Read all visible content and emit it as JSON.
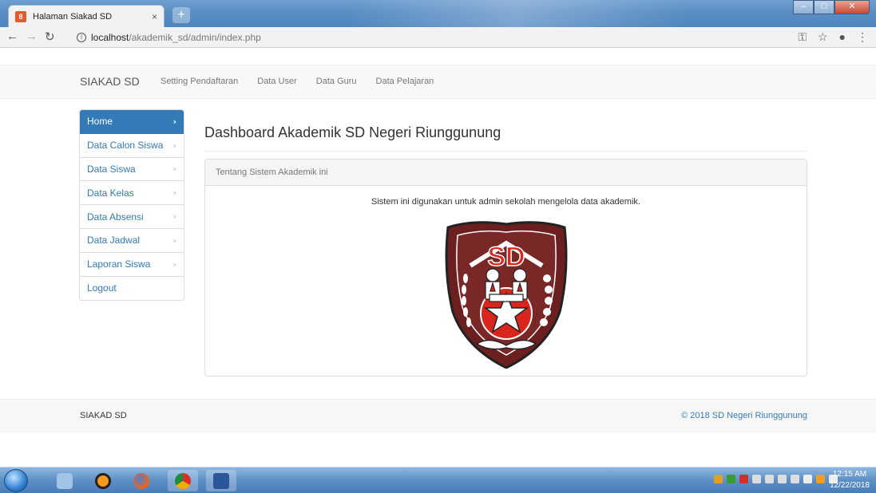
{
  "browser": {
    "tab_title": "Halaman Siakad SD",
    "tab_close": "×",
    "new_tab": "+",
    "url_host": "localhost",
    "url_path": "/akademik_sd/admin/index.php",
    "info_icon": "i"
  },
  "navbar": {
    "brand": "SIAKAD SD",
    "links": [
      "Setting Pendaftaran",
      "Data User",
      "Data Guru",
      "Data Pelajaran"
    ]
  },
  "sidebar": {
    "items": [
      {
        "label": "Home",
        "active": true
      },
      {
        "label": "Data Calon Siswa"
      },
      {
        "label": "Data Siswa"
      },
      {
        "label": "Data Kelas"
      },
      {
        "label": "Data Absensi"
      },
      {
        "label": "Data Jadwal"
      },
      {
        "label": "Laporan Siswa"
      },
      {
        "label": "Logout"
      }
    ]
  },
  "main": {
    "title": "Dashboard Akademik SD Negeri Riunggunung",
    "panel_heading": "Tentang Sistem Akademik ini",
    "panel_text": "Sistem ini digunakan untuk admin sekolah mengelola data akademik.",
    "logo_text": "SD"
  },
  "footer": {
    "left": "SIAKAD SD",
    "right": "© 2018 SD Negeri Riunggunung"
  },
  "taskbar": {
    "time": "12:15 AM",
    "date": "12/22/2018"
  },
  "colors": {
    "primary": "#337ab7",
    "logo_maroon": "#6b1f1f",
    "logo_red": "#d9261c"
  }
}
